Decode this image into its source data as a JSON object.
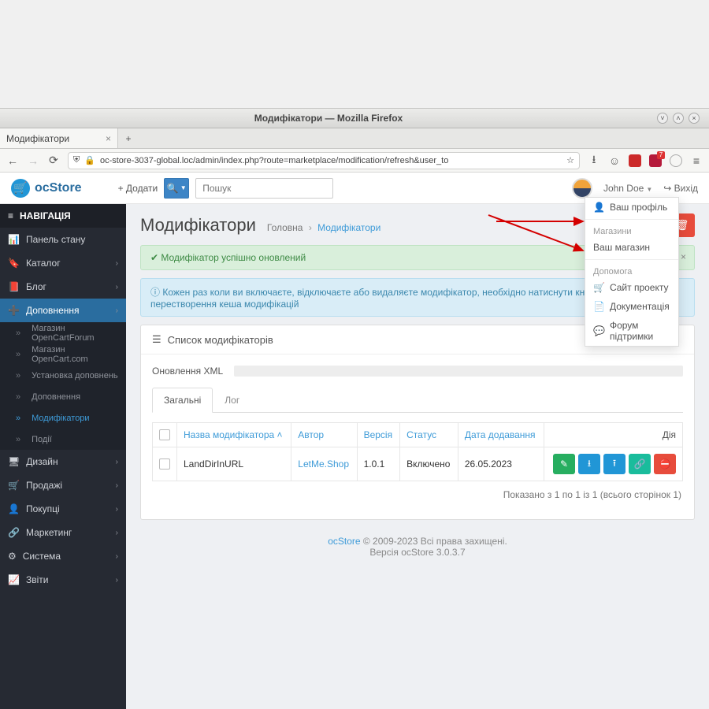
{
  "os": {
    "title": "Модифікатори — Mozilla Firefox"
  },
  "browser": {
    "tab": "Модифікатори",
    "url": "oc-store-3037-global.loc/admin/index.php?route=marketplace/modification/refresh&user_to",
    "badge": "7"
  },
  "header": {
    "brand": "ocStore",
    "add": "+ Додати",
    "search_placeholder": "Пошук",
    "user": "John Doe",
    "logout": "Вихід"
  },
  "sidebar": {
    "title": "НАВІГАЦІЯ",
    "items": [
      "Панель стану",
      "Каталог",
      "Блог",
      "Доповнення",
      "Дизайн",
      "Продажі",
      "Покупці",
      "Маркетинг",
      "Система",
      "Звіти"
    ],
    "addons": [
      "Магазин OpenCartForum",
      "Магазин OpenCart.com",
      "Установка доповнень",
      "Доповнення",
      "Модифікатори",
      "Події"
    ]
  },
  "page": {
    "title": "Модифікатори",
    "crumb_home": "Головна",
    "crumb_here": "Модифікатори",
    "alert_success": "Модифікатор успішно оновлений",
    "alert_info": "Кожен раз коли ви включаєте, відключаєте або видаляєте модифікатор, необхідно натиснути кнопку оновлення, для перестворення кеша модифікацій",
    "list_title": "Список модифікаторів",
    "xml_label": "Оновлення XML",
    "tab_general": "Загальні",
    "tab_log": "Лог",
    "cols": {
      "name": "Назва модифікатора",
      "author": "Автор",
      "version": "Версія",
      "status": "Статус",
      "date": "Дата додавання",
      "action": "Дія"
    },
    "row": {
      "name": "LandDirInURL",
      "author": "LetMe.Shop",
      "version": "1.0.1",
      "status": "Включено",
      "date": "26.05.2023"
    },
    "pager": "Показано з 1 по 1 із 1 (всього сторінок 1)",
    "footer_brand": "ocStore",
    "footer_rest": " © 2009-2023 Всі права захищені.",
    "footer_ver": "Версія ocStore 3.0.3.7"
  },
  "dropdown": {
    "profile": "Ваш профіль",
    "stores_hdr": "Магазини",
    "store": "Ваш магазин",
    "help_hdr": "Допомога",
    "site": "Сайт проекту",
    "docs": "Документація",
    "forum": "Форум підтримки"
  }
}
